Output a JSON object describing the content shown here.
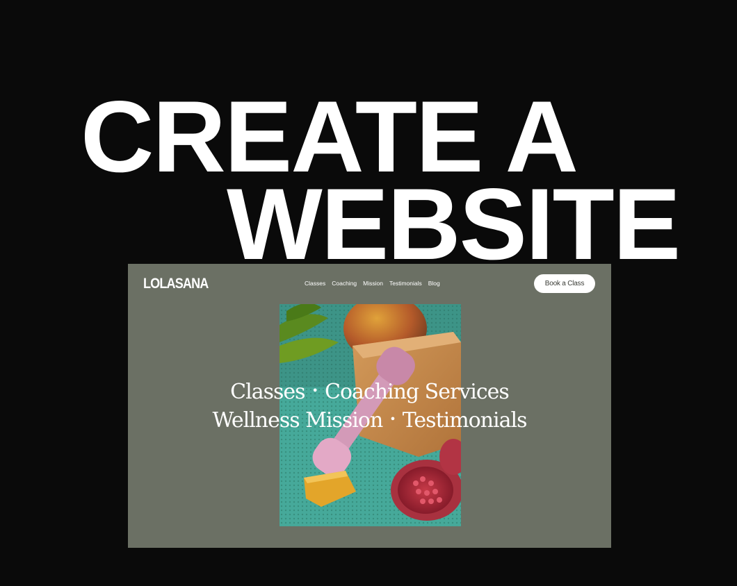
{
  "headline": {
    "line1": "CREATE A",
    "line2": "WEBSITE"
  },
  "site": {
    "logo": "LOLASANA",
    "nav": [
      "Classes",
      "Coaching",
      "Mission",
      "Testimonials",
      "Blog"
    ],
    "cta": "Book a Class",
    "hero": {
      "row1": [
        "Classes",
        "Coaching Services"
      ],
      "row2": [
        "Wellness Mission",
        "Testimonials"
      ],
      "separator": "•"
    },
    "colors": {
      "page_background": "#0a0a0a",
      "site_background": "#6b7064",
      "button_background": "#ffffff",
      "text": "#ffffff"
    }
  }
}
